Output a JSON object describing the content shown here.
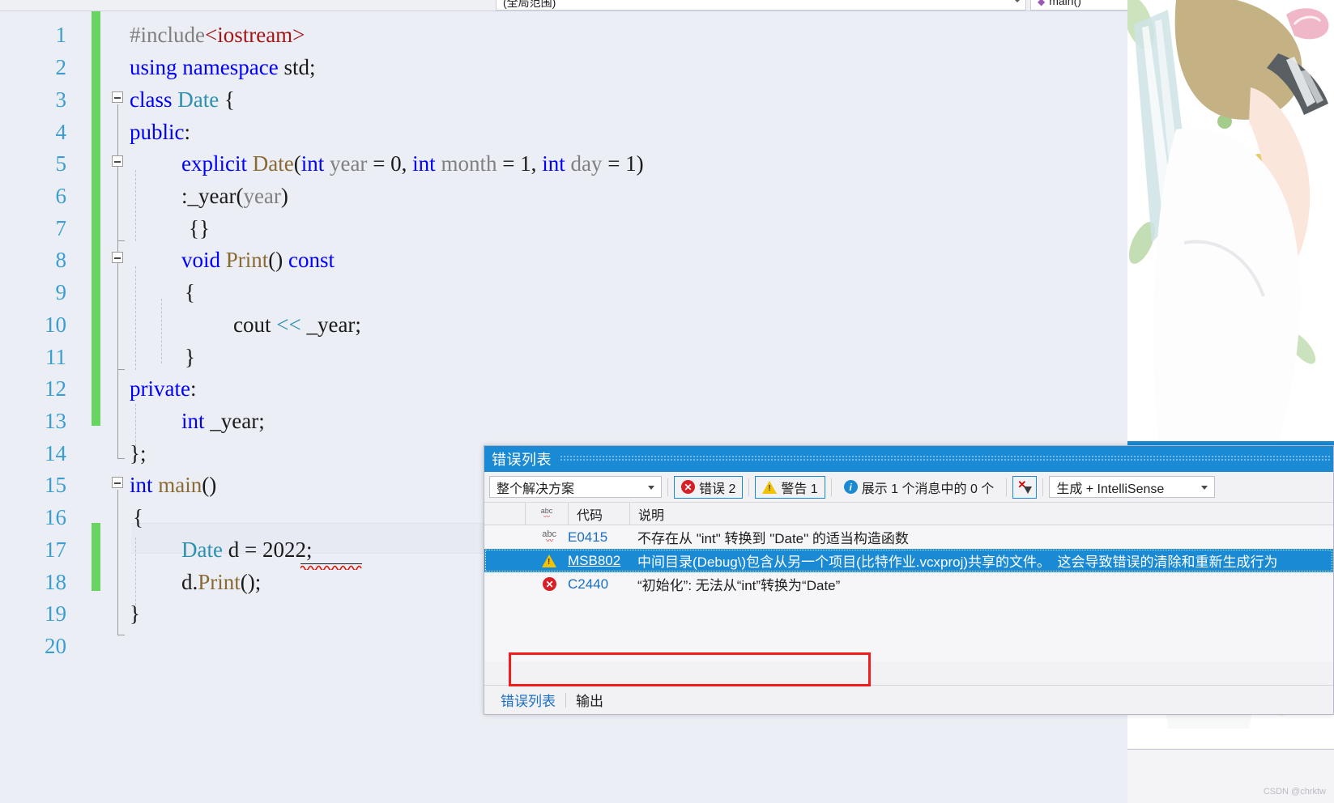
{
  "navbar": {
    "scope_combo": "(全局范围)",
    "member_combo": "main()",
    "member_icon": "method-icon"
  },
  "editor": {
    "line_numbers": [
      "1",
      "2",
      "3",
      "4",
      "5",
      "6",
      "7",
      "8",
      "9",
      "10",
      "11",
      "12",
      "13",
      "14",
      "15",
      "16",
      "17",
      "18",
      "19",
      "20"
    ],
    "lines": [
      {
        "n": 1,
        "text": "#include<iostream>"
      },
      {
        "n": 2,
        "text": "using namespace std;"
      },
      {
        "n": 3,
        "text": "class Date {"
      },
      {
        "n": 4,
        "text": "public:"
      },
      {
        "n": 5,
        "text": "    explicit Date(int year = 0, int month = 1, int day = 1)"
      },
      {
        "n": 6,
        "text": "    :_year(year)"
      },
      {
        "n": 7,
        "text": "    {}"
      },
      {
        "n": 8,
        "text": "    void Print() const"
      },
      {
        "n": 9,
        "text": "    {"
      },
      {
        "n": 10,
        "text": "        cout << _year;"
      },
      {
        "n": 11,
        "text": "    }"
      },
      {
        "n": 12,
        "text": "private:"
      },
      {
        "n": 13,
        "text": "    int _year;"
      },
      {
        "n": 14,
        "text": "};"
      },
      {
        "n": 15,
        "text": "int main()"
      },
      {
        "n": 16,
        "text": "{"
      },
      {
        "n": 17,
        "text": "    Date d = 2022;"
      },
      {
        "n": 18,
        "text": "    d.Print();"
      },
      {
        "n": 19,
        "text": "}"
      },
      {
        "n": 20,
        "text": ""
      }
    ],
    "caret_line": 17,
    "error_squiggle_token": "2022"
  },
  "error_list": {
    "title": "错误列表",
    "scope_filter": "整个解决方案",
    "errors_label": "错误 2",
    "warnings_label": "警告 1",
    "messages_label": "展示 1 个消息中的 0 个",
    "filter_button": "clear-filter-icon",
    "build_filter": "生成 + IntelliSense",
    "columns": [
      "",
      "",
      "代码",
      "说明"
    ],
    "column_code": "代码",
    "column_desc": "说明",
    "rows": [
      {
        "icon": "intellisense-icon",
        "code": "E0415",
        "description": "不存在从 \"int\" 转换到 \"Date\" 的适当构造函数",
        "selected": false
      },
      {
        "icon": "warning-icon",
        "code": "MSB802",
        "description": "中间目录(Debug\\)包含从另一个项目(比特作业.vcxproj)共享的文件。　这会导致错误的清除和重新生成行为",
        "selected": true
      },
      {
        "icon": "error-icon",
        "code": "C2440",
        "description": "“初始化”: 无法从“int”转换为“Date”",
        "selected": false,
        "highlighted": true
      }
    ],
    "tabs": [
      {
        "label": "错误列表",
        "active": true
      },
      {
        "label": "输出",
        "active": false
      }
    ]
  },
  "watermark": "CSDN @chrktw",
  "colors": {
    "accent": "#1a8ad4",
    "error": "#d91f26",
    "warning": "#f2c300",
    "changebar": "#69d561",
    "highlight_box": "#f41b1b",
    "keyword": "#0000ff",
    "type": "#2b91af",
    "function": "#8a6a33",
    "preproc": "#808080",
    "string": "#a31515",
    "editor_bg": "#eceef5"
  }
}
